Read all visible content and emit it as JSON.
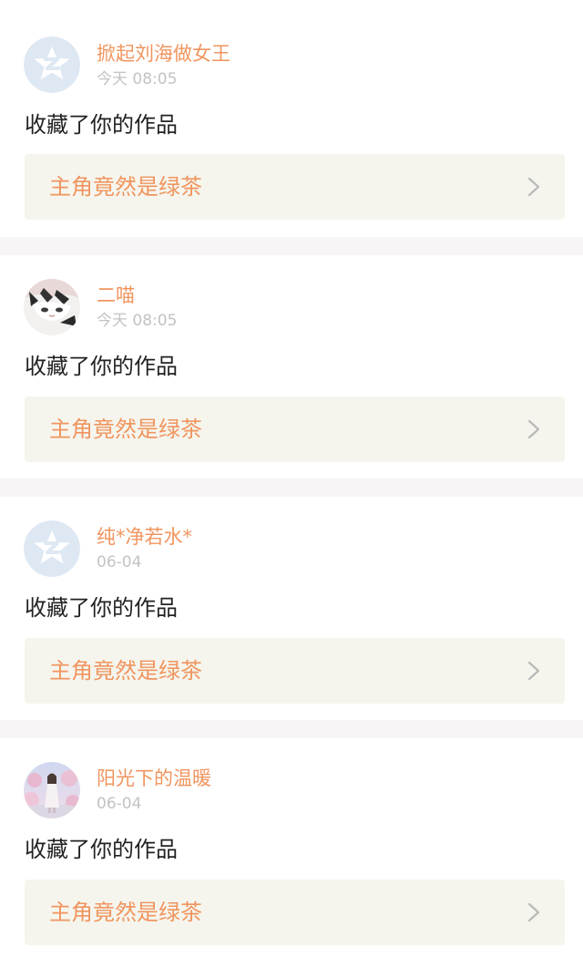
{
  "feed": {
    "items": [
      {
        "username": "掀起刘海做女王",
        "time": "今天 08:05",
        "action": "收藏了你的作品",
        "work_title": "主角竟然是绿茶",
        "avatar": "default-qzone-avatar-icon"
      },
      {
        "username": "二喵",
        "time": "今天 08:05",
        "action": "收藏了你的作品",
        "work_title": "主角竟然是绿茶",
        "avatar": "cat-photo-avatar"
      },
      {
        "username": "纯*净若水*",
        "time": "06-04",
        "action": "收藏了你的作品",
        "work_title": "主角竟然是绿茶",
        "avatar": "default-qzone-avatar-icon"
      },
      {
        "username": "阳光下的温暖",
        "time": "06-04",
        "action": "收藏了你的作品",
        "work_title": "主角竟然是绿茶",
        "avatar": "girl-photo-avatar"
      }
    ]
  },
  "colors": {
    "accent": "#f0955f",
    "tab_indicator": "#e86fa6",
    "link_background": "#f5f5ed",
    "separator": "#f7f5f5",
    "time_text": "#c3c3c3"
  }
}
